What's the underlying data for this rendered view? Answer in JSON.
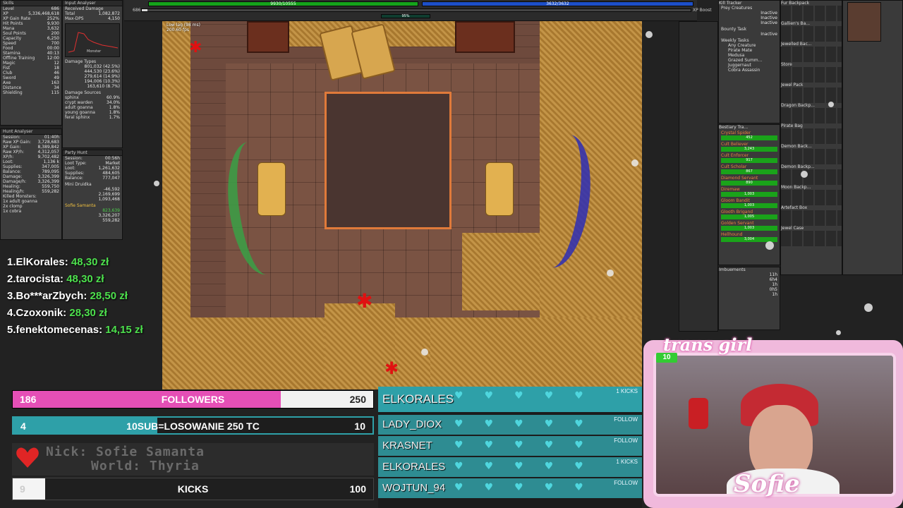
{
  "skills": {
    "title": "Skills",
    "rows": [
      {
        "k": "Level",
        "v": "686"
      },
      {
        "k": "XP",
        "v": "5,336,468,618"
      },
      {
        "k": "XP Gain Rate",
        "v": "252%"
      },
      {
        "k": "Hit Points",
        "v": "9,930"
      },
      {
        "k": "Mana",
        "v": "3,632"
      },
      {
        "k": "Soul Points",
        "v": "200"
      },
      {
        "k": "Capacity",
        "v": "6,250"
      },
      {
        "k": "Speed",
        "v": "700"
      },
      {
        "k": "Food",
        "v": "00:00"
      },
      {
        "k": "Stamina",
        "v": "40:13"
      },
      {
        "k": "Offline Training",
        "v": "12:00"
      },
      {
        "k": "Magic",
        "v": "12"
      },
      {
        "k": "Fist",
        "v": "18"
      },
      {
        "k": "Club",
        "v": "46"
      },
      {
        "k": "Sword",
        "v": "49"
      },
      {
        "k": "Axe",
        "v": "163"
      },
      {
        "k": "Distance",
        "v": "34"
      },
      {
        "k": "Shielding",
        "v": "115"
      }
    ]
  },
  "input_analyser": {
    "title": "Input Analyser",
    "rows": [
      {
        "k": "Total",
        "v": "1,082,872"
      },
      {
        "k": "Max-DPS",
        "v": "4,150"
      }
    ],
    "received_damage": "Received Damage",
    "chart_label": "Monster",
    "damage_types_title": "Damage Types",
    "damage_types": [
      {
        "k": "",
        "v": "801,032 (42.5%)"
      },
      {
        "k": "",
        "v": "444,530 (23.6%)"
      },
      {
        "k": "",
        "v": "279,614 (14.9%)"
      },
      {
        "k": "",
        "v": "194,006 (10.3%)"
      },
      {
        "k": "",
        "v": "163,610 (8.7%)"
      }
    ],
    "damage_sources_title": "Damage Sources",
    "damage_sources": [
      {
        "k": "sphinx",
        "v": "60.9%"
      },
      {
        "k": "crypt warden",
        "v": "34.0%"
      },
      {
        "k": "adult goanna",
        "v": "1.8%"
      },
      {
        "k": "young goanna",
        "v": "1.8%"
      },
      {
        "k": "feral sphinx",
        "v": "1.7%"
      }
    ]
  },
  "hunt_analyser": {
    "title": "Hunt Analyser",
    "rows": [
      {
        "k": "Session:",
        "v": "01:40h"
      },
      {
        "k": "Raw XP Gain:",
        "v": "3,728,683"
      },
      {
        "k": "XP Gain:",
        "v": "8,389,842"
      },
      {
        "k": "Raw XP/h:",
        "v": "4,312,057"
      },
      {
        "k": "XP/h:",
        "v": "9,702,482"
      },
      {
        "k": "Loot:",
        "v": "1,136 k"
      },
      {
        "k": "Supplies:",
        "v": "347,005"
      },
      {
        "k": "Balance:",
        "v": "789,095"
      },
      {
        "k": "Damage:",
        "v": "3,326,399"
      },
      {
        "k": "Damage/h:",
        "v": "3,326,399"
      },
      {
        "k": "Healing:",
        "v": "559,750"
      },
      {
        "k": "Healing/h:",
        "v": "559,282"
      },
      {
        "k": "Killed Monsters:",
        "v": ""
      },
      {
        "k": "1x adult goanna",
        "v": ""
      },
      {
        "k": "2x clomp",
        "v": ""
      },
      {
        "k": "1x cobra",
        "v": ""
      }
    ]
  },
  "party_hunt": {
    "title": "Party Hunt",
    "rows": [
      {
        "k": "Session:",
        "v": "00:56h"
      },
      {
        "k": "Loot Type:",
        "v": "Market"
      },
      {
        "k": "Loot:",
        "v": "1,261,632"
      },
      {
        "k": "Supplies:",
        "v": "484,605"
      },
      {
        "k": "Balance:",
        "v": "777,047"
      }
    ],
    "members": [
      {
        "name": "Mini Druidka",
        "rows": [
          {
            "k": "",
            "v": "-46,592"
          },
          {
            "k": "",
            "v": "2,169,699"
          },
          {
            "k": "",
            "v": "1,093,468"
          }
        ]
      },
      {
        "name": "Sofie Samanta",
        "rows": [
          {
            "k": "",
            "v": "823,639"
          },
          {
            "k": "",
            "v": "3,326,207"
          },
          {
            "k": "",
            "v": "559,282"
          }
        ]
      }
    ]
  },
  "status": {
    "hp": "9930/10555",
    "mp": "3632/3632",
    "level": "686",
    "xp_boost": "XP Boost",
    "stamina_pct": "95%",
    "low_lag": "Low lag (98 ms)",
    "fps": "200.60 fps"
  },
  "kill_tracker": {
    "title": "Kill Tracker",
    "prey_title": "Prey Creatures",
    "prey": [
      "Inactive",
      "Inactive",
      "Inactive"
    ],
    "bounty_title": "Bounty Task",
    "bounty": "Inactive",
    "weekly_title": "Weekly Tasks",
    "weekly": [
      "Any Creature",
      "Pirate Mate",
      "Medusa",
      "Grazed Summ...",
      "Juggernaut",
      "Cobra Assassin"
    ]
  },
  "bestiary": {
    "title": "Bestiary Tra...",
    "entries": [
      {
        "name": "Crystal Spider",
        "count": "452"
      },
      {
        "name": "Cult Believer",
        "count": "3,243"
      },
      {
        "name": "Cult Enforcer",
        "count": "917"
      },
      {
        "name": "Cult Scholar",
        "count": "867"
      },
      {
        "name": "Diamond Servant",
        "count": "890"
      },
      {
        "name": "Diremaw",
        "count": "1,003"
      },
      {
        "name": "Gloom Bandit",
        "count": "1,003"
      },
      {
        "name": "Glooth Brigand",
        "count": "1,005"
      },
      {
        "name": "Golden Servant",
        "count": "1,003"
      },
      {
        "name": "Hellhound",
        "count": "3,004"
      }
    ]
  },
  "imbuements": {
    "title": "Imbuements",
    "times": [
      "11h",
      "6h4",
      "1h",
      "0h5",
      "1h"
    ]
  },
  "containers": [
    "Fur Backpack",
    "Gallien's Ba...",
    "Jewelled Bac...",
    "Store",
    "Jewel Pack",
    "Dragon Backp...",
    "Pirate Bag",
    "Demon Back...",
    "Demon Backp...",
    "Moon Backp...",
    "Artefact Box",
    "Jewel Case"
  ],
  "donations": [
    {
      "rank": "1.ElKorales:",
      "amount": "48,30 zł"
    },
    {
      "rank": "2.tarocista:",
      "amount": "48,30 zł"
    },
    {
      "rank": "3.Bo***arZbych:",
      "amount": "28,50 zł"
    },
    {
      "rank": "4.Czoxonik:",
      "amount": "28,30 zł"
    },
    {
      "rank": "5.fenektomecenas:",
      "amount": "14,15 zł"
    }
  ],
  "goals": {
    "followers": {
      "current": "186",
      "title": "FOLLOWERS",
      "max": "250",
      "progress": 0.744
    },
    "subs": {
      "current": "4",
      "title": "10SUB=LOSOWANIE 250 TC",
      "max": "10",
      "progress": 0.4
    },
    "kicks": {
      "current": "9",
      "title": "KICKS",
      "max": "100",
      "progress": 0.09
    }
  },
  "nick_info": {
    "nick": "Nick: Sofie Samanta",
    "world": "World: Thyria"
  },
  "feed": [
    {
      "name": "ELKORALES",
      "tag": "1 KICKS"
    },
    {
      "name": "LADY_DIOX",
      "tag": "FOLLOW"
    },
    {
      "name": "KRASNET",
      "tag": "FOLLOW"
    },
    {
      "name": "ELKORALES",
      "tag": "1 KICKS"
    },
    {
      "name": "WOJTUN_94",
      "tag": "FOLLOW"
    }
  ],
  "webcam": {
    "title": "trans girl",
    "name": "Sofie",
    "badge": "10"
  },
  "colors": {
    "accent_pink": "#e63fa8",
    "accent_teal": "#2ea0a8",
    "donation_green": "#4de04d",
    "hp_green": "#15a31b",
    "mp_blue": "#1d4fc8"
  }
}
